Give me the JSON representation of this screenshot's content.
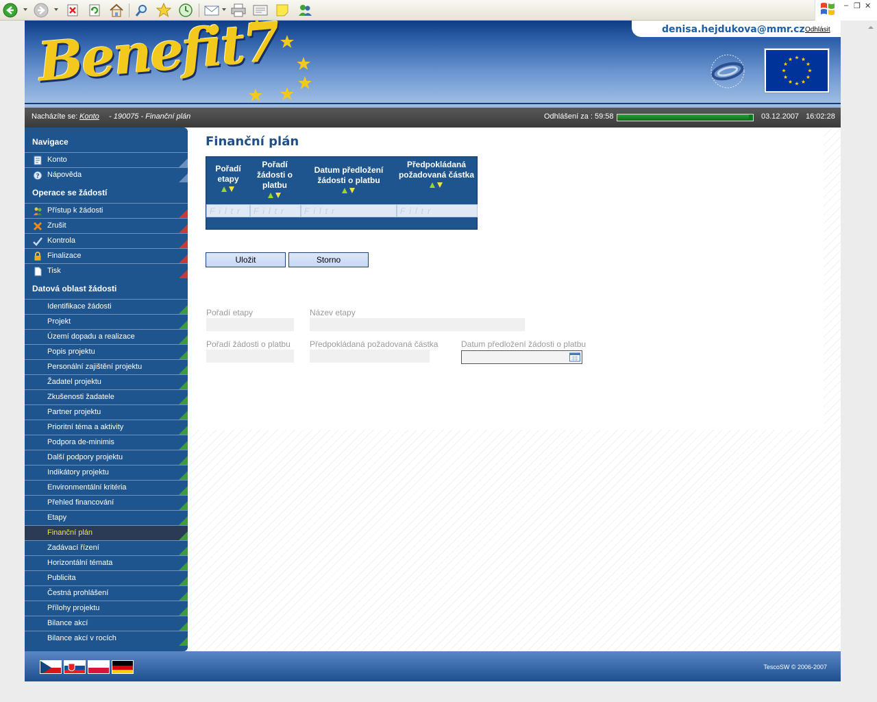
{
  "browser": {
    "toolbar_icons": [
      "back-icon",
      "forward-icon",
      "stop-icon",
      "refresh-icon",
      "home-icon",
      "search-icon",
      "favorites-icon",
      "history-icon",
      "mail-icon",
      "print-icon",
      "edit-icon",
      "note-icon",
      "messenger-icon"
    ]
  },
  "header": {
    "logo": "Benefit7",
    "user_email": "denisa.hejdukova@mmr.cz",
    "logout_label": "Odhlásit",
    "ministry_logo": "ministerstvo-pro-mistni-rozvoj-logo",
    "eu_flag": "eu-flag"
  },
  "crumbbar": {
    "location_label": "Nacházíte se:",
    "link": "Konto",
    "rest": "- 190075 - Finanční plán",
    "timeout_label": "Odhlášení za : 59:58",
    "timeout_progress": 0.97,
    "date": "03.12.2007",
    "time": "16:02:28"
  },
  "sidebar": {
    "sections": [
      {
        "title": "Navigace",
        "items": [
          "Konto",
          "Nápověda"
        ]
      },
      {
        "title": "Operace se žádostí",
        "items": [
          "Přístup k žádosti",
          "Zrušit",
          "Kontrola",
          "Finalizace",
          "Tisk"
        ]
      },
      {
        "title": "Datová oblast žádosti",
        "items": [
          "Identifikace žádosti",
          "Projekt",
          "Území dopadu a realizace",
          "Popis projektu",
          "Personální zajištění projektu",
          "Žadatel projektu",
          "Zkušenosti žadatele",
          "Partner projektu",
          "Prioritní téma a aktivity",
          "Podpora de-minimis",
          "Další podpory projektu",
          "Indikátory projektu",
          "Environmentální kritéria",
          "Přehled financování",
          "Etapy",
          "Finanční plán",
          "Zadávací řízení",
          "Horizontální témata",
          "Publicita",
          "Čestná prohlášení",
          "Přílohy projektu",
          "Bilance akcí",
          "Bilance akcí v rocích"
        ]
      }
    ],
    "active_item": "Finanční plán"
  },
  "main": {
    "title": "Finanční plán",
    "grid": {
      "columns": [
        "Pořadí etapy",
        "Pořadí žádosti o platbu",
        "Datum předložení žádosti o platbu",
        "Předpokládaná požadovaná částka"
      ],
      "filter_placeholder": "Filtr"
    },
    "buttons": {
      "save": "Uložit",
      "cancel": "Storno"
    },
    "form": {
      "poradi_etapy": "Pořadí etapy",
      "nazev_etapy": "Název etapy",
      "poradi_zadosti": "Pořadí žádosti o platbu",
      "castka": "Předpokládaná požadovaná částka",
      "datum": "Datum předložení žádosti o platbu"
    }
  },
  "footer": {
    "flags": [
      "czech-flag",
      "slovak-flag",
      "polish-flag",
      "german-flag"
    ],
    "copyright": "TescoSW © 2006-2007"
  },
  "colors": {
    "nav_blue": "#1e558f",
    "active_text": "#f2e24e",
    "title_blue": "#1e4f86"
  }
}
